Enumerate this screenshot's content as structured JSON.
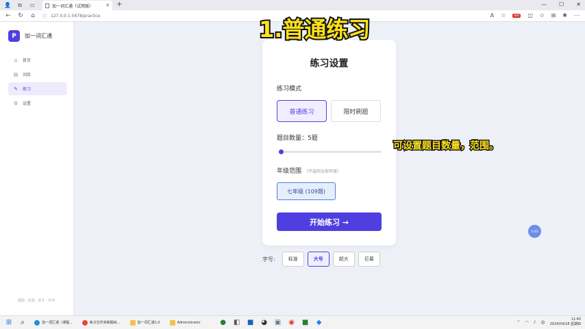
{
  "browser": {
    "tab_title": "加一词汇通（试用版）",
    "url": "127.0.0.1:5678/practice"
  },
  "sidebar": {
    "brand_initial": "P",
    "brand_name": "加一词汇通",
    "items": [
      {
        "label": "首页",
        "icon": "home-icon"
      },
      {
        "label": "词库",
        "icon": "book-icon"
      },
      {
        "label": "练习",
        "icon": "pencil-icon"
      },
      {
        "label": "设置",
        "icon": "gear-icon"
      }
    ],
    "footer": "帮助 · 反馈 · 关于 · 许可"
  },
  "settings": {
    "title": "练习设置",
    "mode_label": "练习模式",
    "modes": [
      "普通练习",
      "限时刷题"
    ],
    "selected_mode": "普通练习",
    "count_label": "题目数量：5题",
    "count_slider_fraction": 0.0,
    "grade_label": "年级范围",
    "grade_hint": "（不选则全部年级）",
    "grade_option": "七年级 (109题)",
    "start_button": "开始练习 →"
  },
  "font_size": {
    "label": "字号:",
    "options": [
      "标准",
      "大号",
      "超大",
      "巨幕"
    ],
    "selected": "大号"
  },
  "floating_button": "1:0/3",
  "overlay": {
    "title": "1.普通练习",
    "caption": "可设置题目数量，范围。"
  },
  "taskbar": {
    "apps": [
      "加一词汇通（课程...",
      "练习文件夹和题目...",
      "加一词汇通1.0",
      "Administrator"
    ],
    "time": "11:40",
    "date": "2024/04/18 星期四"
  },
  "colors": {
    "accent": "#4f3fe0",
    "overlay_text": "#ffe21a",
    "background": "#eef0f8"
  }
}
